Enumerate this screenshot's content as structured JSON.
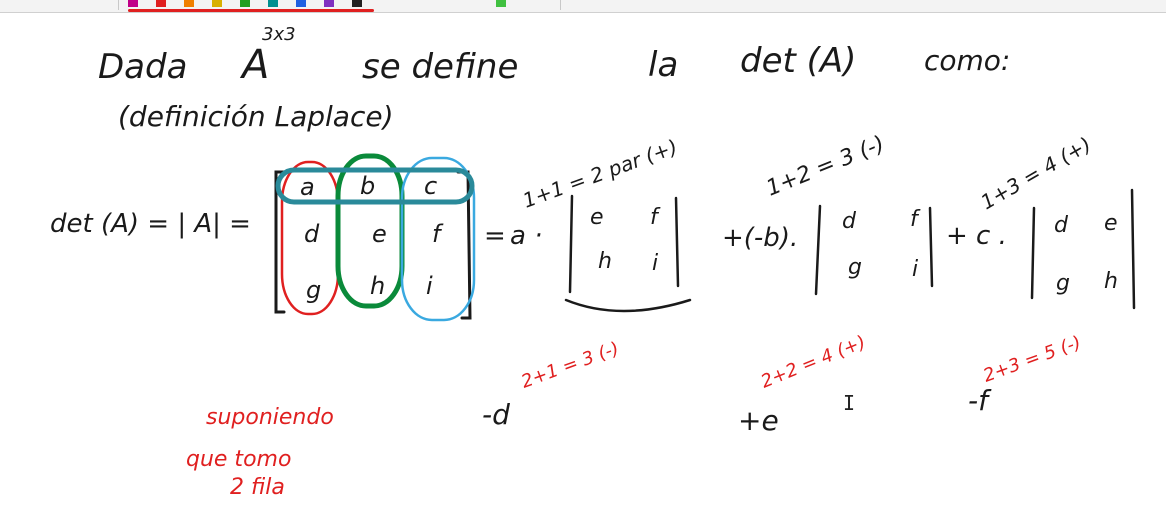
{
  "toolbar": {
    "tools": [
      {
        "icon": "select-icon",
        "color": "#c00088"
      },
      {
        "icon": "pen-red-icon",
        "color": "#e02020"
      },
      {
        "icon": "pen-orange-icon",
        "color": "#f08000"
      },
      {
        "icon": "pen-yellow-icon",
        "color": "#d8b000"
      },
      {
        "icon": "pen-green-icon",
        "color": "#20a020"
      },
      {
        "icon": "pen-teal-icon",
        "color": "#009090"
      },
      {
        "icon": "pen-blue-icon",
        "color": "#2060e0"
      },
      {
        "icon": "pen-purple-icon",
        "color": "#8030c0"
      },
      {
        "icon": "pen-black-icon",
        "color": "#222222"
      },
      {
        "icon": "highlighter-icon",
        "color": "#40c040"
      }
    ]
  },
  "notes": {
    "heading": {
      "dada": "Dada",
      "matrix": "A",
      "dims": "3x3",
      "se_define": "se define",
      "la": "la",
      "det_a": "det (A)",
      "como": "como:",
      "laplace": "(definición Laplace)"
    },
    "lhs": "det (A) = | A| =",
    "matrix": {
      "rows": [
        [
          "a",
          "b",
          "c"
        ],
        [
          "d",
          "e",
          "f"
        ],
        [
          "g",
          "h",
          "i"
        ]
      ]
    },
    "expansion": {
      "equals": "=",
      "term1": {
        "coef": "a ·",
        "label": "1+1 = 2 par (+)",
        "minor": [
          [
            "e",
            "f"
          ],
          [
            "h",
            "i"
          ]
        ]
      },
      "term2": {
        "coef": "+(-b).",
        "label": "1+2 = 3 (-)",
        "minor": [
          [
            "d",
            "f"
          ],
          [
            "g",
            "i"
          ]
        ]
      },
      "term3": {
        "coef": "+ c .",
        "label": "1+3 = 4 (+)",
        "minor": [
          [
            "d",
            "e"
          ],
          [
            "g",
            "h"
          ]
        ]
      }
    },
    "row2": {
      "note_line1": "suponiendo",
      "note_line2": "que tomo",
      "note_line3": "2 fila",
      "c1": {
        "label": "2+1 = 3 (-)",
        "term": "-d"
      },
      "c2": {
        "label": "2+2 = 4 (+)",
        "term": "+e"
      },
      "c3": {
        "label": "2+3 = 5 (-)",
        "term": "-f"
      }
    }
  },
  "colors": {
    "ink": "#1a1a1a",
    "red": "#e02020",
    "green": "#0a8a3a",
    "blue": "#3aa9e0",
    "teal": "#2a8a9a"
  }
}
